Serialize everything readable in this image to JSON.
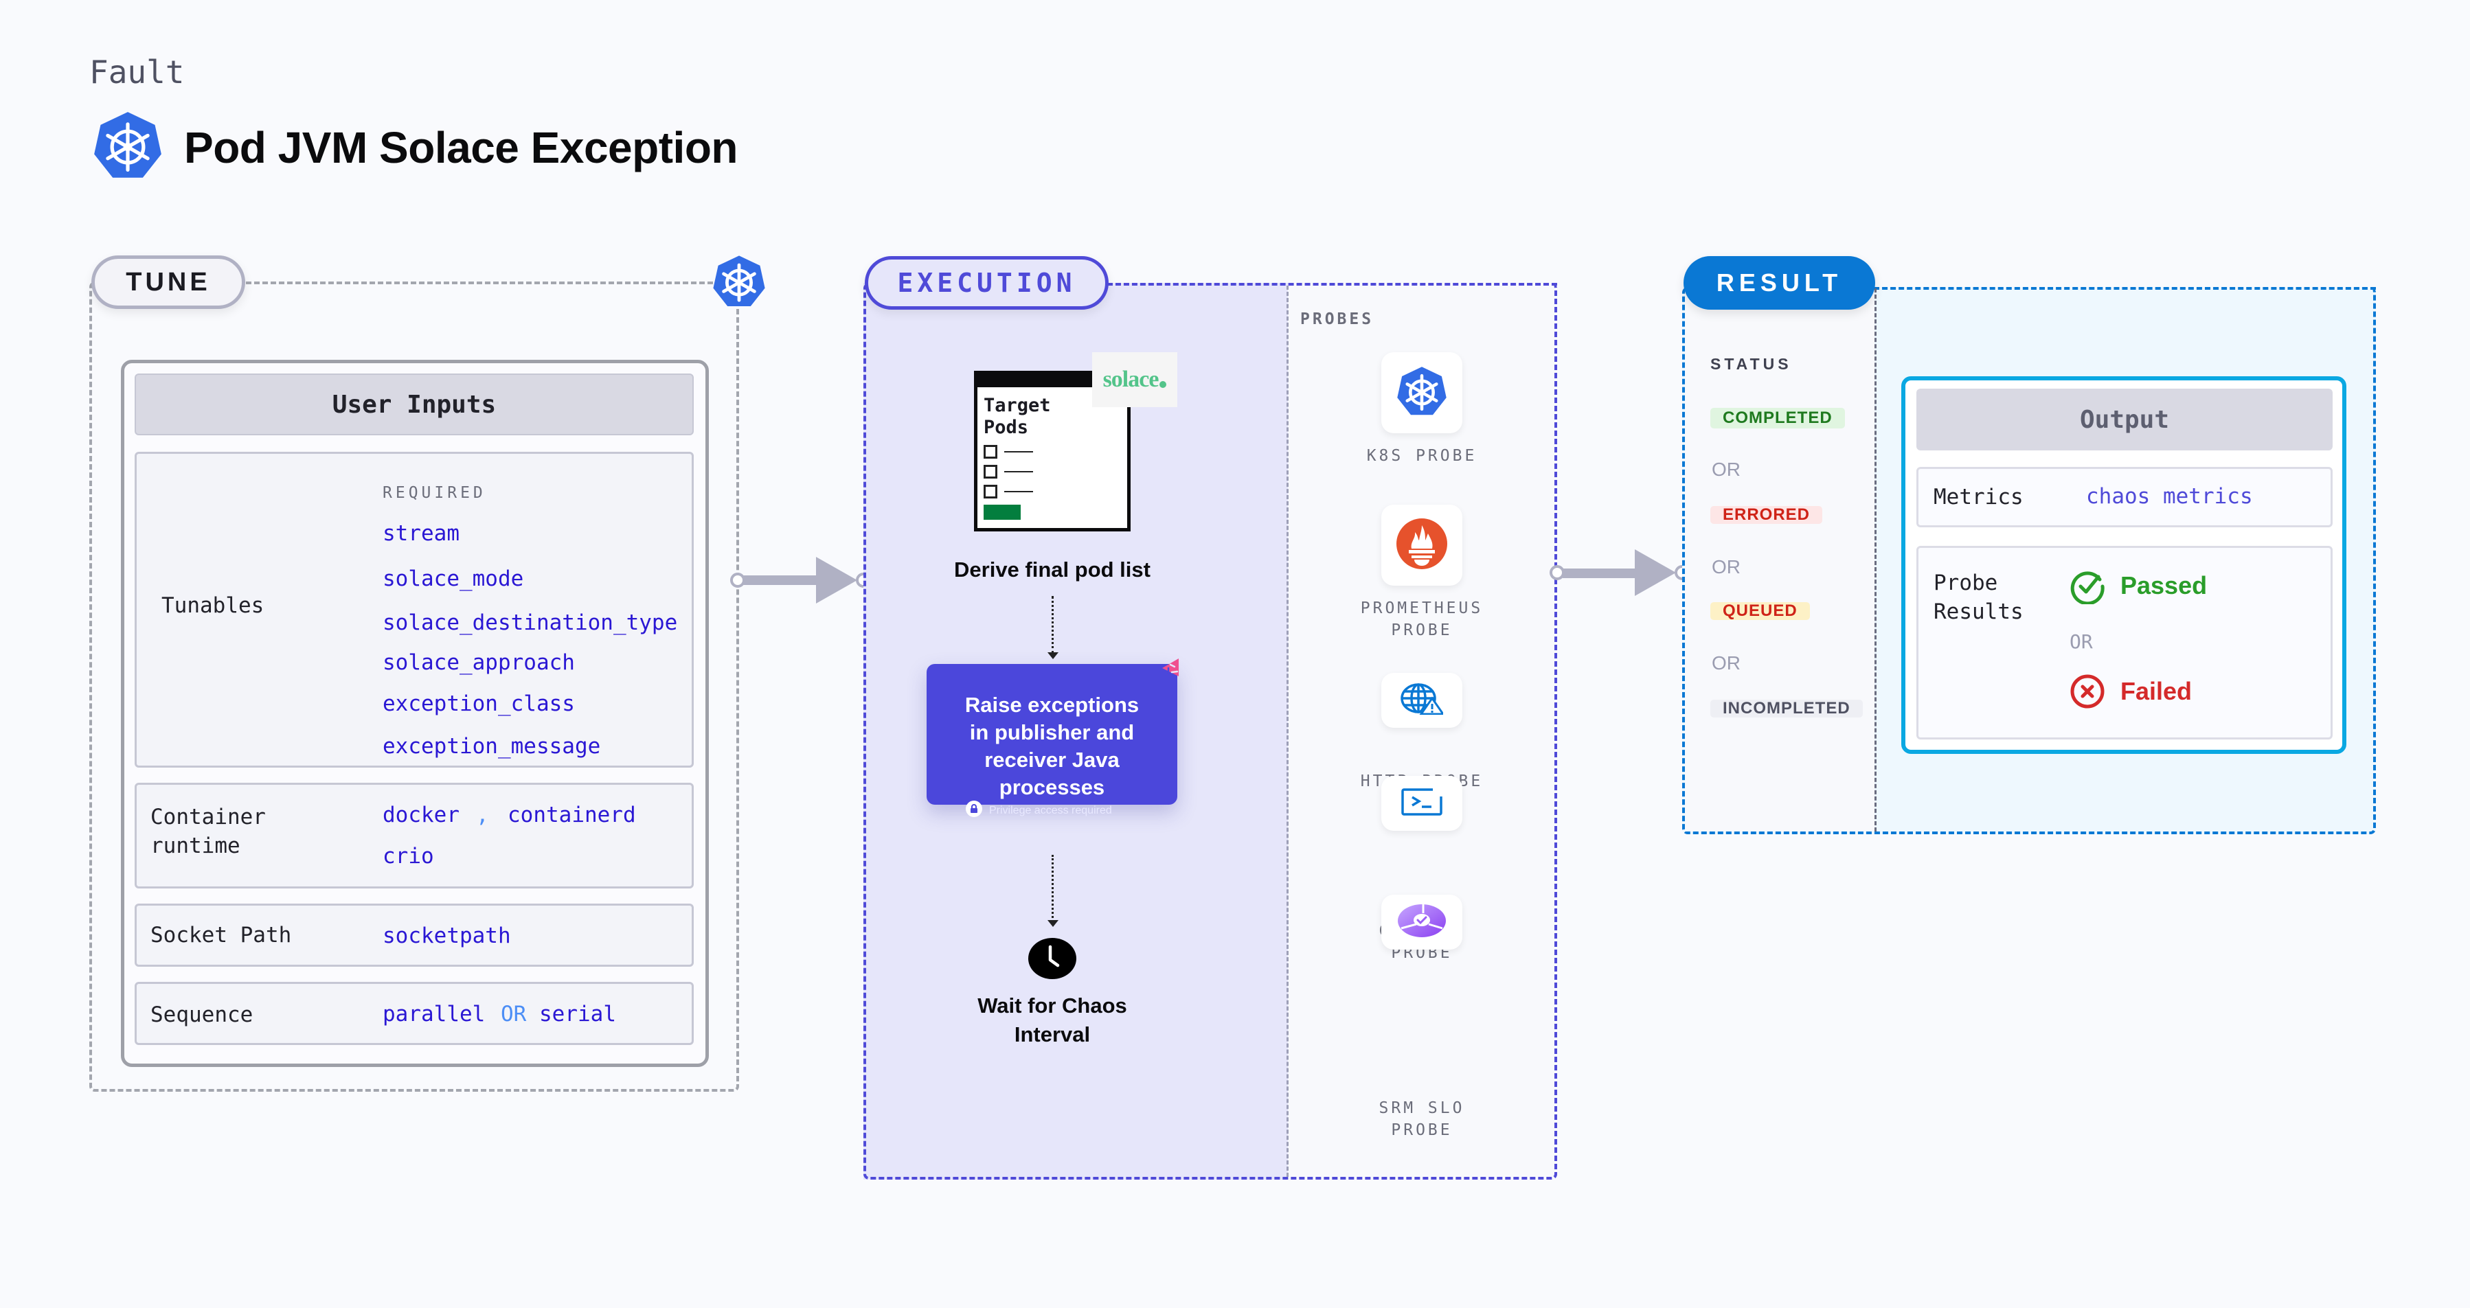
{
  "header": {
    "kicker": "Fault",
    "title": "Pod JVM Solace Exception",
    "icon": "kubernetes-icon"
  },
  "tune": {
    "pill_label": "TUNE",
    "panel_title": "User Inputs",
    "tunables": {
      "label": "Tunables",
      "required_label": "REQUIRED",
      "items": [
        "stream",
        "solace_mode",
        "solace_destination_type",
        "solace_approach",
        "exception_class",
        "exception_message"
      ]
    },
    "container_runtime": {
      "label_line1": "Container",
      "label_line2": "runtime",
      "values": [
        "docker",
        "containerd",
        "crio"
      ],
      "separator": ","
    },
    "socket_path": {
      "label": "Socket Path",
      "value": "socketpath"
    },
    "sequence": {
      "label": "Sequence",
      "value_a": "parallel",
      "or": "OR",
      "value_b": "serial"
    }
  },
  "execution": {
    "pill_label": "EXECUTION",
    "target_card": {
      "title_line1": "Target",
      "title_line2": "Pods",
      "brand_logo": "solace"
    },
    "steps": [
      {
        "label": "Derive final pod list"
      },
      {
        "label_lines": [
          "Raise exceptions",
          "in publisher and",
          "receiver Java",
          "processes"
        ],
        "note": "Privilege access required"
      },
      {
        "label_lines": [
          "Wait for Chaos",
          "Interval"
        ]
      }
    ],
    "probes_title": "PROBES",
    "probes": [
      {
        "label_lines": [
          "K8S PROBE"
        ],
        "icon": "kubernetes-icon"
      },
      {
        "label_lines": [
          "PROMETHEUS",
          "PROBE"
        ],
        "icon": "prometheus-icon"
      },
      {
        "label_lines": [
          "HTTP PROBE"
        ],
        "icon": "globe-warning-icon"
      },
      {
        "label_lines": [
          "COMMAND",
          "PROBE"
        ],
        "icon": "terminal-icon"
      },
      {
        "label_lines": [
          "SRM SLO",
          "PROBE"
        ],
        "icon": "slo-icon"
      }
    ]
  },
  "result": {
    "pill_label": "RESULT",
    "status_title": "STATUS",
    "statuses": [
      {
        "label": "COMPLETED",
        "color": "#1f7a1f",
        "bg": "#e0f5e0"
      },
      {
        "label": "ERRORED",
        "color": "#cf2318",
        "bg": "#fde6e6"
      },
      {
        "label": "QUEUED",
        "color": "#cf2318",
        "bg": "#fdf1c6"
      },
      {
        "label": "INCOMPLETED",
        "color": "#4f5162",
        "bg": "#eeeff4"
      }
    ],
    "or_label": "OR",
    "output": {
      "title": "Output",
      "metrics_label": "Metrics",
      "metrics_value": "chaos metrics",
      "probe_results_line1": "Probe",
      "probe_results_line2": "Results",
      "passed": "Passed",
      "or": "OR",
      "failed": "Failed"
    }
  },
  "colors": {
    "execution_accent": "#4f4ad8",
    "result_accent": "#0a78d4",
    "value_blue": "#2a17d4",
    "passed_green": "#2a9d2a",
    "failed_red": "#d42a2a"
  }
}
